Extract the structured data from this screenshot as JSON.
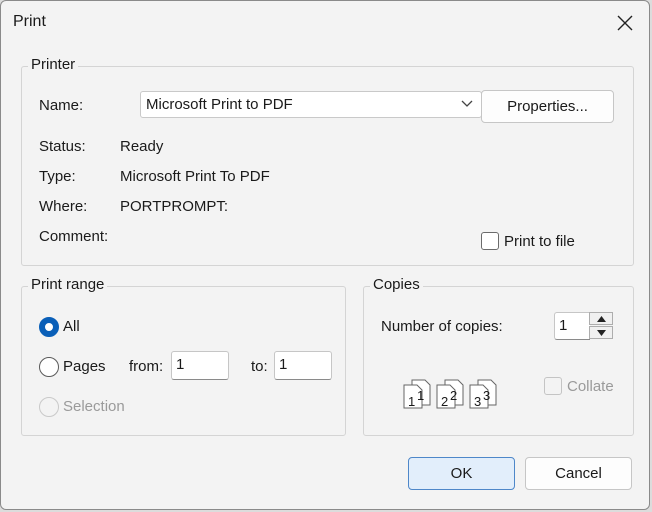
{
  "dialog": {
    "title": "Print",
    "close_icon": "close-icon"
  },
  "printer": {
    "group_label": "Printer",
    "name_label": "Name:",
    "name_value": "Microsoft Print to PDF",
    "properties_label": "Properties...",
    "status_label": "Status:",
    "status_value": "Ready",
    "type_label": "Type:",
    "type_value": "Microsoft Print To PDF",
    "where_label": "Where:",
    "where_value": "PORTPROMPT:",
    "comment_label": "Comment:",
    "comment_value": "",
    "print_to_file_label": "Print to file",
    "print_to_file_checked": false
  },
  "print_range": {
    "group_label": "Print range",
    "all_label": "All",
    "pages_label": "Pages",
    "from_label": "from:",
    "from_value": "1",
    "to_label": "to:",
    "to_value": "1",
    "selection_label": "Selection",
    "selected": "all"
  },
  "copies": {
    "group_label": "Copies",
    "number_label": "Number of copies:",
    "number_value": "1",
    "collate_label": "Collate",
    "collate_checked": false,
    "collate_pages": [
      "1",
      "1",
      "2",
      "2",
      "3",
      "3"
    ]
  },
  "buttons": {
    "ok_label": "OK",
    "cancel_label": "Cancel"
  },
  "colors": {
    "accent": "#0a5fb8",
    "primary_button_bg": "#e2eefb"
  }
}
